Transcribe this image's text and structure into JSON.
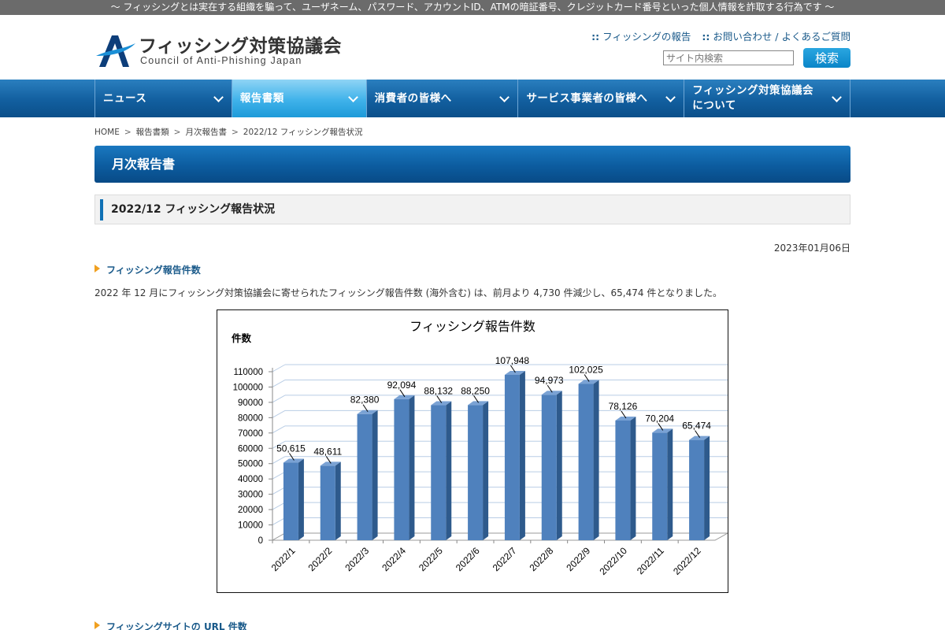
{
  "topbar": {
    "text": "〜 フィッシングとは実在する組織を騙って、ユーザネーム、パスワード、アカウントID、ATMの暗証番号、クレジットカード番号といった個人情報を詐取する行為です 〜"
  },
  "header": {
    "logo_jp": "フィッシング対策協議会",
    "logo_en": "Council of Anti-Phishing Japan",
    "links": [
      "フィッシングの報告",
      "お問い合わせ / よくあるご質問"
    ],
    "links_prefix": "::",
    "search_placeholder": "サイト内検索",
    "search_button": "検索"
  },
  "nav": {
    "items": [
      {
        "label": "ニュース"
      },
      {
        "label": "報告書類",
        "active": true
      },
      {
        "label": "消費者の皆様へ"
      },
      {
        "label": "サービス事業者の皆様へ"
      },
      {
        "label": "フィッシング対策協議会\nについて"
      }
    ]
  },
  "breadcrumb": [
    "HOME",
    "報告書類",
    "月次報告書",
    "2022/12 フィッシング報告状況"
  ],
  "breadcrumb_sep": ">",
  "section_title": "月次報告書",
  "page_title": "2022/12 フィッシング報告状況",
  "date": "2023年01月06日",
  "subhead1": "フィッシング報告件数",
  "paragraph": "2022 年 12 月にフィッシング対策協議会に寄せられたフィッシング報告件数 (海外含む) は、前月より 4,730 件減少し、65,474 件となりました。",
  "subhead2": "フィッシングサイトの URL 件数",
  "chart_data": {
    "type": "bar",
    "title": "フィッシング報告件数",
    "ylabel": "件数",
    "xlabel": "",
    "categories": [
      "2022/1",
      "2022/2",
      "2022/3",
      "2022/4",
      "2022/5",
      "2022/6",
      "2022/7",
      "2022/8",
      "2022/9",
      "2022/10",
      "2022/11",
      "2022/12"
    ],
    "values": [
      50615,
      48611,
      82380,
      92094,
      88132,
      88250,
      107948,
      94973,
      102025,
      78126,
      70204,
      65474
    ],
    "value_labels": [
      "50,615",
      "48,611",
      "82,380",
      "92,094",
      "88,132",
      "88,250",
      "107,948",
      "94,973",
      "102,025",
      "78,126",
      "70,204",
      "65,474"
    ],
    "y_ticks": [
      "0",
      "10000",
      "20000",
      "30000",
      "40000",
      "50000",
      "60000",
      "70000",
      "80000",
      "90000",
      "100000",
      "110000"
    ],
    "ylim": [
      0,
      110000
    ],
    "grid": true,
    "bar_color": "#4f81bd"
  }
}
